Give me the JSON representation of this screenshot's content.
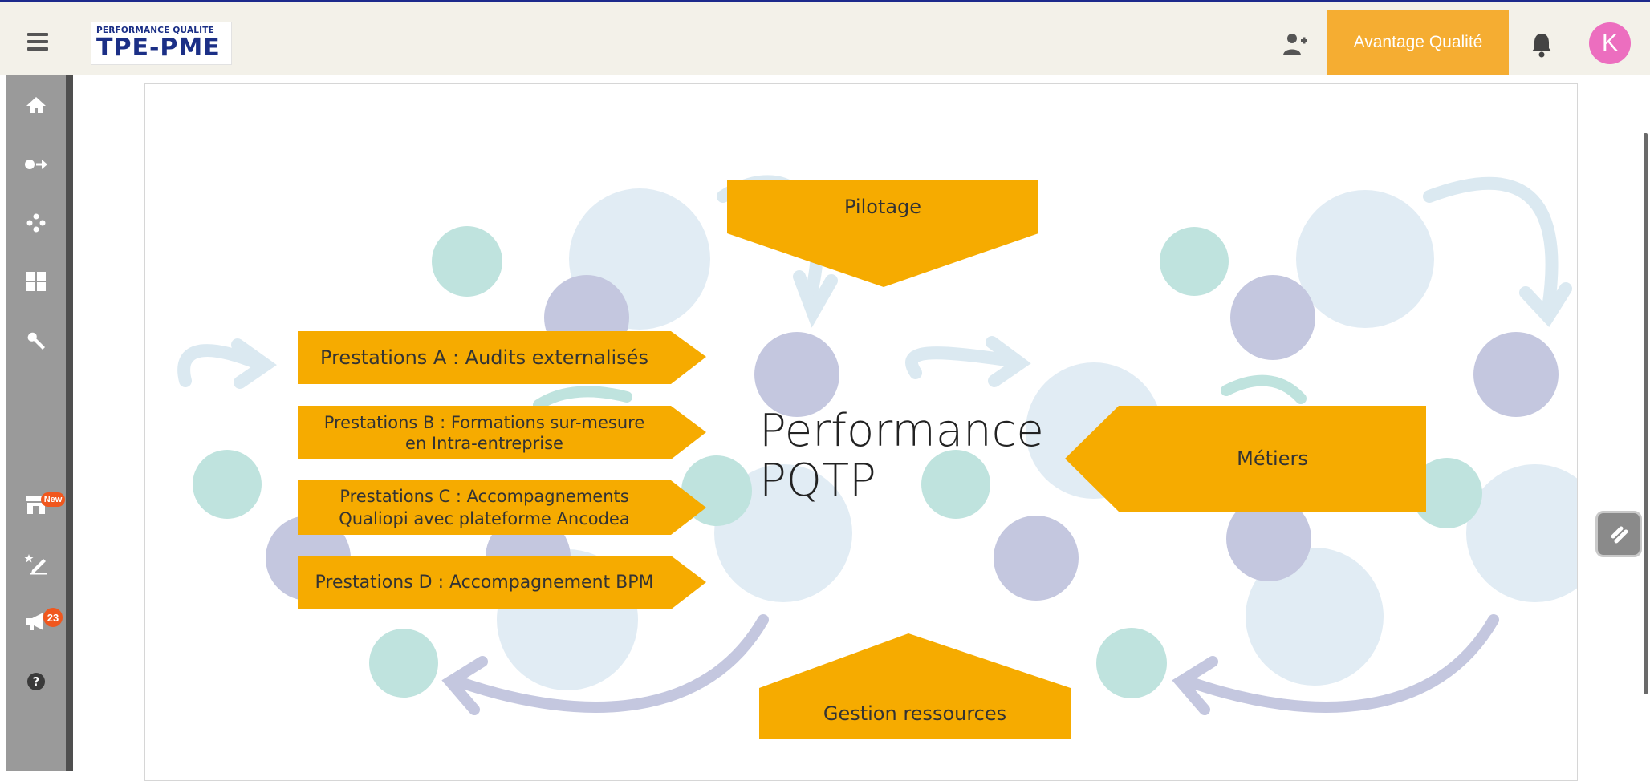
{
  "header": {
    "logo": {
      "top_text": "PERFORMANCE QUALITE",
      "main_text": "TPE-PME"
    },
    "advantage_button": "Avantage Qualité",
    "avatar_initial": "K",
    "icons": [
      "menu-icon",
      "add-user-icon",
      "bell-icon"
    ]
  },
  "sidebar": {
    "items": [
      {
        "icon": "home-icon"
      },
      {
        "icon": "login-arrow-icon"
      },
      {
        "icon": "network-icon"
      },
      {
        "icon": "dashboard-grid-icon"
      },
      {
        "icon": "wrench-icon"
      },
      {
        "icon": "store-icon",
        "badge": "New"
      },
      {
        "icon": "edit-star-icon"
      },
      {
        "icon": "megaphone-icon",
        "badge": "23"
      },
      {
        "icon": "help-icon"
      }
    ]
  },
  "slide": {
    "pilotage": "Pilotage",
    "center_line1": "Performance",
    "center_line2": "PQTP",
    "metiers": "Métiers",
    "gestion": "Gestion ressources",
    "prestations": [
      {
        "line1": "Prestations A : Audits externalisés",
        "line2": ""
      },
      {
        "line1": "Prestations B : Formations sur-mesure",
        "line2": "en Intra-entreprise"
      },
      {
        "line1": "Prestations C : Accompagnements",
        "line2": "Qualiopi avec plateforme Ancodea"
      },
      {
        "line1": "Prestations D : Accompagnement BPM",
        "line2": ""
      }
    ]
  },
  "colors": {
    "accent": "#f5ad32",
    "box": "#f6ab00",
    "sidebar": "#9a9a9a",
    "avatar": "#ec6ebf",
    "badge": "#f0571e",
    "top_line": "#1c2a8c"
  }
}
